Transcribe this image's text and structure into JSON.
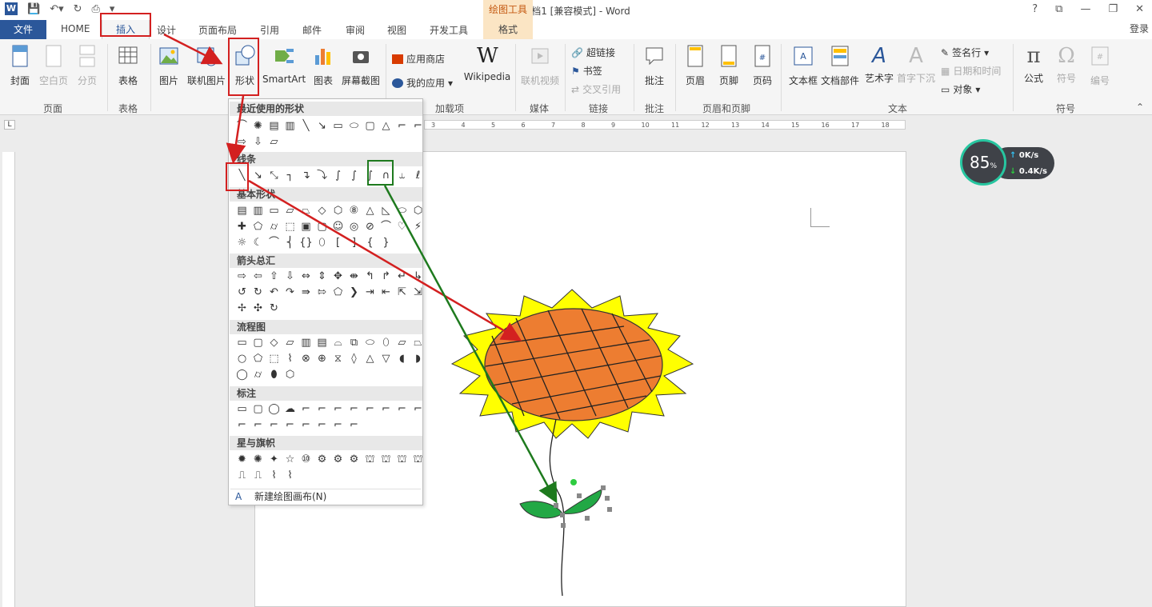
{
  "titlebar": {
    "title": "文档1 [兼容模式] - Word",
    "drawing_tools": "绘图工具",
    "window_controls": [
      "?",
      "⧉",
      "—",
      "❐",
      "✕"
    ]
  },
  "tabs": {
    "file": "文件",
    "home": "HOME",
    "insert": "插入",
    "design": "设计",
    "layout": "页面布局",
    "references": "引用",
    "mailings": "邮件",
    "review": "审阅",
    "view": "视图",
    "developer": "开发工具",
    "format": "格式",
    "login": "登录"
  },
  "ribbon": {
    "cover": "封面",
    "blank_page": "空白页",
    "page_break": "分页",
    "group_pages": "页面",
    "table": "表格",
    "group_tables": "表格",
    "pictures": "图片",
    "online_pictures": "联机图片",
    "shapes": "形状",
    "smartart": "SmartArt",
    "chart": "图表",
    "screenshot": "屏幕截图",
    "app_store": "应用商店",
    "my_apps": "我的应用",
    "wikipedia": "Wikipedia",
    "group_addins": "加载项",
    "online_video": "联机视频",
    "group_media": "媒体",
    "hyperlink": "超链接",
    "bookmark": "书签",
    "cross_reference": "交叉引用",
    "group_links": "链接",
    "comment": "批注",
    "group_comments": "批注",
    "header": "页眉",
    "footer": "页脚",
    "page_number": "页码",
    "group_header_footer": "页眉和页脚",
    "text_box": "文本框",
    "quick_parts": "文档部件",
    "wordart": "艺术字",
    "drop_cap": "首字下沉",
    "signature_line": "签名行",
    "date_time": "日期和时间",
    "object": "对象",
    "group_text": "文本",
    "equation": "公式",
    "symbol": "符号",
    "numbering": "编号",
    "group_symbols": "符号"
  },
  "ruler_numbers": [
    "3",
    "4",
    "5",
    "6",
    "7",
    "8",
    "9",
    "10",
    "11",
    "12",
    "13",
    "14",
    "15",
    "16",
    "17",
    "18"
  ],
  "shapes_menu": {
    "recent": "最近使用的形状",
    "lines": "线条",
    "basic": "基本形状",
    "arrows": "箭头总汇",
    "flowchart": "流程图",
    "callouts": "标注",
    "stars": "星与旗帜",
    "new_canvas": "新建绘图画布(N)"
  },
  "net_widget": {
    "percent": "85",
    "pct_sign": "%",
    "up": "0K/s",
    "down": "0.4K/s"
  },
  "colors": {
    "accent": "#2b579a",
    "highlight_red": "#d32020",
    "highlight_green": "#1e7a1e",
    "petal": "#ffff00",
    "flower_center": "#ed7d31",
    "leaf": "#22a845"
  }
}
